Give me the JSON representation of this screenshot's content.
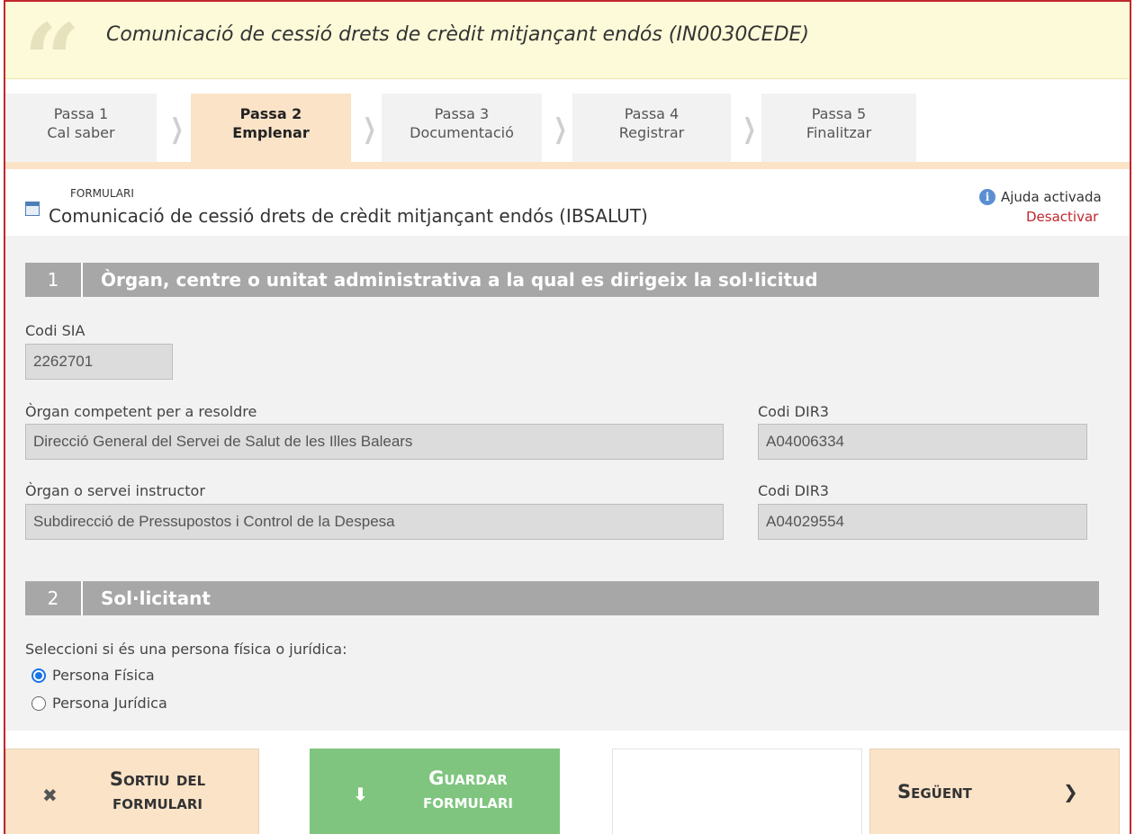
{
  "header": {
    "title": "Comunicació de cessió drets de crèdit mitjançant endós (IN0030CEDE)"
  },
  "steps": [
    {
      "line1": "Passa 1",
      "line2": "Cal saber",
      "active": false
    },
    {
      "line1": "Passa 2",
      "line2": "Emplenar",
      "active": true
    },
    {
      "line1": "Passa 3",
      "line2": "Documentació",
      "active": false
    },
    {
      "line1": "Passa 4",
      "line2": "Registrar",
      "active": false
    },
    {
      "line1": "Passa 5",
      "line2": "Finalitzar",
      "active": false
    }
  ],
  "form": {
    "label": "FORMULARI",
    "title": "Comunicació de cessió drets de crèdit mitjançant endós (IBSALUT)",
    "help_on": "Ajuda activada",
    "help_off": "Desactivar"
  },
  "section1": {
    "num": "1",
    "title": "Òrgan, centre o unitat administrativa a la qual es dirigeix la sol·licitud",
    "codi_sia_label": "Codi SIA",
    "codi_sia_value": "2262701",
    "organ_label": "Òrgan competent per a resoldre",
    "organ_value": "Direcció General del Servei de Salut de les Illes Balears",
    "dir3_label_1": "Codi DIR3",
    "dir3_value_1": "A04006334",
    "instructor_label": "Òrgan o servei instructor",
    "instructor_value": "Subdirecció de Pressupostos i Control de la Despesa",
    "dir3_label_2": "Codi DIR3",
    "dir3_value_2": "A04029554"
  },
  "section2": {
    "num": "2",
    "title": "Sol·licitant",
    "prompt": "Seleccioni si és una persona física o jurídica:",
    "options": [
      "Persona Física",
      "Persona Jurídica"
    ],
    "selected": "Persona Física"
  },
  "buttons": {
    "exit_line1": "Sortiu del",
    "exit_line2": "formulari",
    "save_line1": "Guardar",
    "save_line2": "formulari",
    "next": "Següent"
  },
  "icons": {
    "exit": "close-icon",
    "save": "download-icon",
    "next": "chevron-right-icon",
    "help": "info-icon",
    "form": "form-document-icon",
    "quote": "quote-icon"
  },
  "colors": {
    "accent": "#c0272d",
    "header_bg": "#fcfad8",
    "active_step": "#fbe3c8",
    "section_bar": "#a7a7a7",
    "save_button": "#7fc57f"
  }
}
